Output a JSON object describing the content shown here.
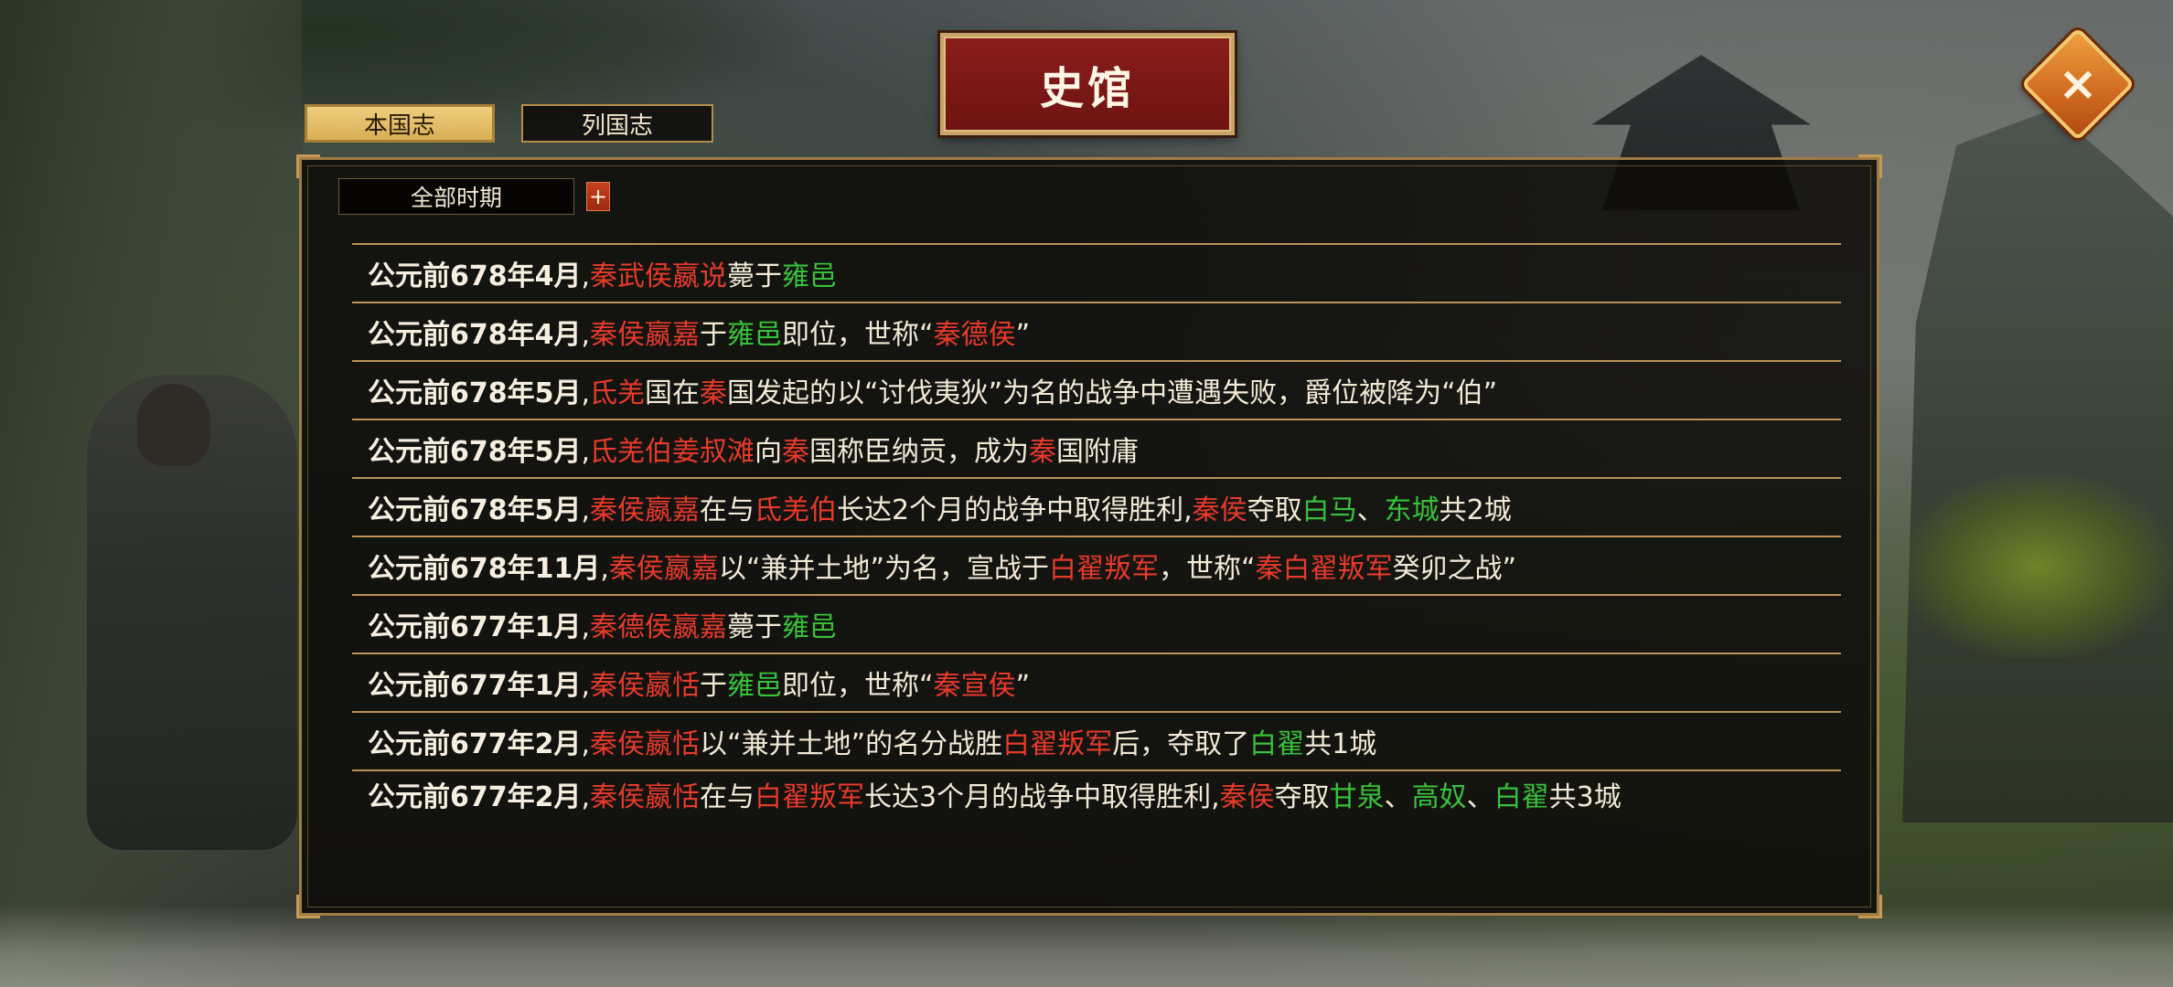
{
  "title": "史馆",
  "close_label": "×",
  "tabs": [
    {
      "label": "本国志",
      "active": true
    },
    {
      "label": "列国志",
      "active": false
    }
  ],
  "filter": {
    "label": "全部时期",
    "expand_label": "+"
  },
  "colors": {
    "person": "#e83a2a",
    "place": "#38c23a",
    "text": "#f3ead6",
    "border": "#b8935a"
  },
  "entries": [
    {
      "segments": [
        {
          "t": "公元前678年4月",
          "c": "date"
        },
        {
          "t": ",",
          "c": "plain"
        },
        {
          "t": "秦武侯嬴说",
          "c": "red"
        },
        {
          "t": "薨于",
          "c": "plain"
        },
        {
          "t": "雍邑",
          "c": "green"
        }
      ]
    },
    {
      "segments": [
        {
          "t": "公元前678年4月",
          "c": "date"
        },
        {
          "t": ",",
          "c": "plain"
        },
        {
          "t": "秦侯嬴嘉",
          "c": "red"
        },
        {
          "t": "于",
          "c": "plain"
        },
        {
          "t": "雍邑",
          "c": "green"
        },
        {
          "t": "即位，世称“",
          "c": "plain"
        },
        {
          "t": "秦德侯",
          "c": "red"
        },
        {
          "t": "”",
          "c": "plain"
        }
      ]
    },
    {
      "segments": [
        {
          "t": "公元前678年5月",
          "c": "date"
        },
        {
          "t": ",",
          "c": "plain"
        },
        {
          "t": "氐羌",
          "c": "red"
        },
        {
          "t": "国在",
          "c": "plain"
        },
        {
          "t": "秦",
          "c": "red"
        },
        {
          "t": "国发起的以“讨伐夷狄”为名的战争中遭遇失败，爵位被降为“伯”",
          "c": "plain"
        }
      ]
    },
    {
      "segments": [
        {
          "t": "公元前678年5月",
          "c": "date"
        },
        {
          "t": ",",
          "c": "plain"
        },
        {
          "t": "氐羌伯姜叔滩",
          "c": "red"
        },
        {
          "t": "向",
          "c": "plain"
        },
        {
          "t": "秦",
          "c": "red"
        },
        {
          "t": "国称臣纳贡，成为",
          "c": "plain"
        },
        {
          "t": "秦",
          "c": "red"
        },
        {
          "t": "国附庸",
          "c": "plain"
        }
      ]
    },
    {
      "segments": [
        {
          "t": "公元前678年5月",
          "c": "date"
        },
        {
          "t": ",",
          "c": "plain"
        },
        {
          "t": "秦侯嬴嘉",
          "c": "red"
        },
        {
          "t": "在与",
          "c": "plain"
        },
        {
          "t": "氐羌伯",
          "c": "red"
        },
        {
          "t": "长达2个月的战争中取得胜利,",
          "c": "plain"
        },
        {
          "t": "秦侯",
          "c": "red"
        },
        {
          "t": "夺取",
          "c": "plain"
        },
        {
          "t": "白马",
          "c": "green"
        },
        {
          "t": "、",
          "c": "plain"
        },
        {
          "t": "东城",
          "c": "green"
        },
        {
          "t": "共2城",
          "c": "plain"
        }
      ]
    },
    {
      "segments": [
        {
          "t": "公元前678年11月",
          "c": "date"
        },
        {
          "t": ",",
          "c": "plain"
        },
        {
          "t": "秦侯嬴嘉",
          "c": "red"
        },
        {
          "t": "以“兼并土地”为名，宣战于",
          "c": "plain"
        },
        {
          "t": "白翟叛军",
          "c": "red"
        },
        {
          "t": "，世称“",
          "c": "plain"
        },
        {
          "t": "秦白翟叛军",
          "c": "red"
        },
        {
          "t": "癸卯之战”",
          "c": "plain"
        }
      ]
    },
    {
      "segments": [
        {
          "t": "公元前677年1月",
          "c": "date"
        },
        {
          "t": ",",
          "c": "plain"
        },
        {
          "t": "秦德侯嬴嘉",
          "c": "red"
        },
        {
          "t": "薨于",
          "c": "plain"
        },
        {
          "t": "雍邑",
          "c": "green"
        }
      ]
    },
    {
      "segments": [
        {
          "t": "公元前677年1月",
          "c": "date"
        },
        {
          "t": ",",
          "c": "plain"
        },
        {
          "t": "秦侯嬴恬",
          "c": "red"
        },
        {
          "t": "于",
          "c": "plain"
        },
        {
          "t": "雍邑",
          "c": "green"
        },
        {
          "t": "即位，世称“",
          "c": "plain"
        },
        {
          "t": "秦宣侯",
          "c": "red"
        },
        {
          "t": "”",
          "c": "plain"
        }
      ]
    },
    {
      "segments": [
        {
          "t": "公元前677年2月",
          "c": "date"
        },
        {
          "t": ",",
          "c": "plain"
        },
        {
          "t": "秦侯嬴恬",
          "c": "red"
        },
        {
          "t": "以“兼并土地”的名分战胜",
          "c": "plain"
        },
        {
          "t": "白翟叛军",
          "c": "red"
        },
        {
          "t": "后，夺取了",
          "c": "plain"
        },
        {
          "t": "白翟",
          "c": "green"
        },
        {
          "t": "共1城",
          "c": "plain"
        }
      ]
    },
    {
      "segments": [
        {
          "t": "公元前677年2月",
          "c": "date"
        },
        {
          "t": ",",
          "c": "plain"
        },
        {
          "t": "秦侯嬴恬",
          "c": "red"
        },
        {
          "t": "在与",
          "c": "plain"
        },
        {
          "t": "白翟叛军",
          "c": "red"
        },
        {
          "t": "长达3个月的战争中取得胜利,",
          "c": "plain"
        },
        {
          "t": "秦侯",
          "c": "red"
        },
        {
          "t": "夺取",
          "c": "plain"
        },
        {
          "t": "甘泉",
          "c": "green"
        },
        {
          "t": "、",
          "c": "plain"
        },
        {
          "t": "高奴",
          "c": "green"
        },
        {
          "t": "、",
          "c": "plain"
        },
        {
          "t": "白翟",
          "c": "green"
        },
        {
          "t": "共3城",
          "c": "plain"
        }
      ],
      "tall": true
    }
  ]
}
